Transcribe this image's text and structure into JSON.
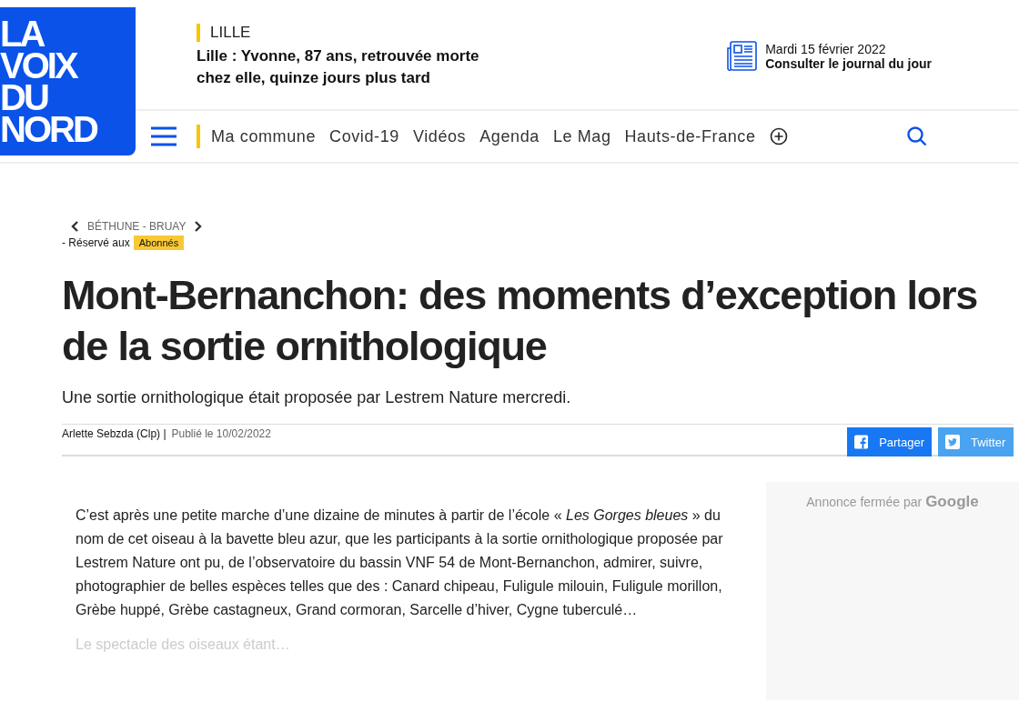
{
  "logo": {
    "lines": [
      "LA",
      "VOIX",
      "DU",
      "NORD"
    ]
  },
  "top_story": {
    "section": "LILLE",
    "headline": "Lille : Yvonne, 87 ans, retrouvée morte chez elle, quinze jours plus tard"
  },
  "edition": {
    "date": "Mardi 15 février 2022",
    "link": "Consulter le journal du jour"
  },
  "nav": {
    "items": [
      "Ma commune",
      "Covid-19",
      "Vidéos",
      "Agenda",
      "Le Mag",
      "Hauts-de-France"
    ]
  },
  "breadcrumb": {
    "label": "BÉTHUNE - BRUAY"
  },
  "access": {
    "text": "- Réservé aux",
    "badge": "Abonnés"
  },
  "article": {
    "title_lines": [
      "Mont-Bernanchon: des moments d’exception lors",
      "de la sortie ornithologique"
    ],
    "lead": "Une sortie ornithologique était proposée par Lestrem Nature mercredi.",
    "author": "Arlette Sebzda (Clp) |",
    "published": "Publié le 10/02/2022",
    "share": [
      {
        "kind": "facebook",
        "label": "Partager"
      },
      {
        "kind": "twitter",
        "label": "Twitter"
      }
    ],
    "paragraphs": [
      "C’est après une petite marche d’une dizaine de minutes à partir de l’école «  *Les Gorges bleues*  » du nom de cet oiseau à la bavette bleu azur, que les participants à la sortie ornithologique proposée par Lestrem Nature ont pu, de l’observatoire du bassin VNF 54 de Mont-Bernanchon, admirer, suivre, photographier de belles espèces telles que des : Canard chipeau, Fuligule milouin, Fuligule morillon, Grèbe huppé, Grèbe castagneux, Grand cormoran, Sarcelle d’hiver, Cygne tuberculé…",
      "Le spectacle des oiseaux étant…"
    ]
  },
  "ad": {
    "text": "Annonce fermée par",
    "brand": "Google"
  }
}
